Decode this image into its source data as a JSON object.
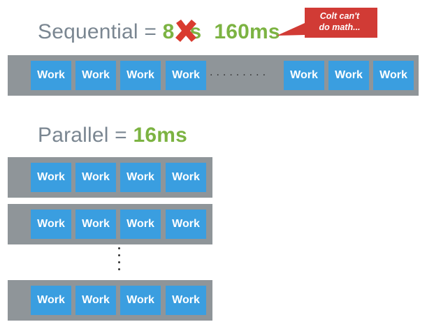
{
  "sequential": {
    "label": "Sequential = ",
    "old_value": "8ms",
    "old_value_visible": "8",
    "old_value_tail": "s",
    "new_value": "160ms"
  },
  "callout": {
    "line1": "Colt can't",
    "line2": "do math..."
  },
  "parallel": {
    "label": "Parallel = ",
    "value": "16ms"
  },
  "work_label": "Work",
  "dots": ".........",
  "colors": {
    "lane": "#8f9599",
    "work": "#3a9ee0",
    "accent_green": "#7cb342",
    "callout_red": "#d13b35",
    "cross_red": "#d93b2f"
  }
}
